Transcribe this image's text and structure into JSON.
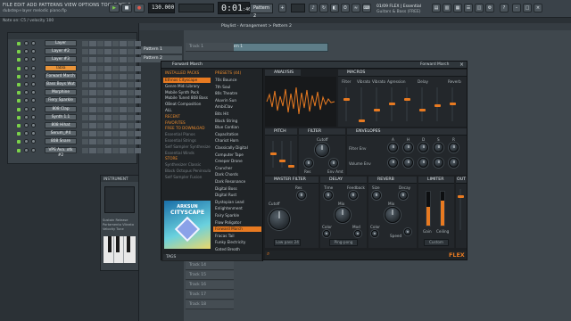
{
  "top": {
    "menu": "FILE  EDIT  ADD  PATTERNS  VIEW  OPTIONS  TOOLS  HELP",
    "project_file": "dubstep+layer melodic piano.flp",
    "hint": "Note on: C5 / velocity 100",
    "tempo": "130.000",
    "time": "0:01",
    "time_frac": ":46",
    "pattern": "Pattern 2",
    "plugin_info_line1": "01/09  FLEX | Essential",
    "plugin_info_line2": "Guitars & Bass (FREE)"
  },
  "channel_rack": {
    "title": "Channel rack",
    "channels": [
      {
        "name": "Layer"
      },
      {
        "name": "Layer #2"
      },
      {
        "name": "Layer #3"
      },
      {
        "name": "Tabla"
      },
      {
        "name": "Forward March"
      },
      {
        "name": "Bass Boys Wut"
      },
      {
        "name": "Morphine"
      },
      {
        "name": "Fiery Sparkle"
      },
      {
        "name": "808 Clap"
      },
      {
        "name": "Synth 1.1"
      },
      {
        "name": "808 Hihat"
      },
      {
        "name": "Serum_#4"
      },
      {
        "name": "808 Snare"
      },
      {
        "name": "VPS Ava..otk #2"
      }
    ],
    "selected_index": 3
  },
  "playlist": {
    "title": "Playlist - Arrangement > Pattern 2",
    "patterns": [
      "Pattern 1",
      "Pattern 2"
    ],
    "tracks": [
      "Track 1",
      "Track 13",
      "Track 14",
      "Track 15",
      "Track 16",
      "Track 17",
      "Track 18"
    ],
    "clip_label": "Pattern 1"
  },
  "small_plugin": {
    "title": "INSTRUMENT",
    "text_lines": [
      "Sustain  Release",
      "Portamento Vibrato",
      "Velocity  Tune"
    ]
  },
  "flex": {
    "title": "Forward March",
    "header_right": "Forward March",
    "logo": "FLEX",
    "browser": {
      "header": "INSTALLED PACKS",
      "items": [
        {
          "label": "Ethnos Cityscape",
          "style": "sel"
        },
        {
          "label": "Genre Midi Library",
          "style": ""
        },
        {
          "label": "Mobile Synth Pack",
          "style": ""
        },
        {
          "label": "Mobile Tuned 808 Bass",
          "style": ""
        },
        {
          "label": "OBeat Composition",
          "style": ""
        },
        {
          "label": "ALL",
          "style": ""
        },
        {
          "label": "RECENT",
          "style": "head"
        },
        {
          "label": "FAVORITES",
          "style": "head"
        },
        {
          "label": "FREE TO DOWNLOAD",
          "style": "head"
        },
        {
          "label": "Essential Pianos",
          "style": "dim"
        },
        {
          "label": "Essential Strings",
          "style": "dim"
        },
        {
          "label": "Self Sampler Synthesizer",
          "style": "dim"
        },
        {
          "label": "Essential Winds",
          "style": "dim"
        },
        {
          "label": "STORE",
          "style": "head"
        },
        {
          "label": "Synthesizer Classic",
          "style": "dim"
        },
        {
          "label": "Black Octopus Peninsula",
          "style": "dim"
        },
        {
          "label": "Self Sampler Fusion",
          "style": "dim"
        }
      ],
      "cover_line1": "ARKSUN",
      "cover_line2": "CITYSCAPE",
      "footer": "TAGS"
    },
    "presets": {
      "header": "PRESETS (44)",
      "items": [
        "70s Bounce",
        "7th Soul",
        "80s Theatre",
        "Aluvrin Sun",
        "AmbiClav",
        "Bits Hit",
        "Black String",
        "Blue Cordian",
        "Capacitation",
        "Chariot Horn",
        "Classically Digital",
        "Computer Tape",
        "Creeper Drone",
        "Cruncher",
        "Dark Chords",
        "Dark Resonance",
        "Digital Boss",
        "Digital Rust",
        "Dystopian Lead",
        "Enlightenment",
        "Fairy Sparkle",
        "Flow Poligator",
        "Forward March",
        "Fracas Tail",
        "Funky Electricity",
        "Gated Breath"
      ],
      "selected_index": 22
    },
    "analysis_label": "ANALYSIS",
    "macros": {
      "header": "MACROS",
      "labels": [
        "Filter",
        "Vibrato",
        "Vibrato",
        "Agression",
        "",
        "Delay",
        "",
        "Reverb"
      ],
      "values": [
        0.7,
        0.0,
        0.35,
        0.55,
        0.7,
        0.35,
        0.5,
        0.55
      ]
    },
    "pitch": {
      "header": "PITCH"
    },
    "filter": {
      "header": "FILTER",
      "labels": [
        "Cutoff",
        "Res",
        "Env Amt"
      ]
    },
    "envelopes": {
      "header": "ENVELOPES",
      "cols": [
        "A",
        "H",
        "D",
        "S",
        "R"
      ],
      "rows": [
        "Filter Env",
        "Volume Env"
      ]
    },
    "master_filter": {
      "header": "MASTER FILTER",
      "labels": [
        "Cutoff",
        "Res"
      ],
      "mode": "Low pass 24"
    },
    "delay": {
      "header": "DELAY",
      "labels": [
        "Time",
        "Feedback",
        "Mix",
        "Color",
        "Mod"
      ],
      "mode": "Ping-pong"
    },
    "reverb": {
      "header": "REVERB",
      "labels": [
        "Size",
        "Decay",
        "Mix",
        "Color",
        "Speed"
      ]
    },
    "limiter": {
      "header": "LIMITER",
      "labels": [
        "Gain",
        "Ceiling"
      ],
      "mode": "Custom",
      "gain_level": 0.55,
      "ceiling_level": 0.75
    },
    "out_label": "OUT"
  },
  "colors": {
    "accent": "#e87a21",
    "selected_channel": "#e8943a",
    "led_green": "#7bd24a"
  }
}
